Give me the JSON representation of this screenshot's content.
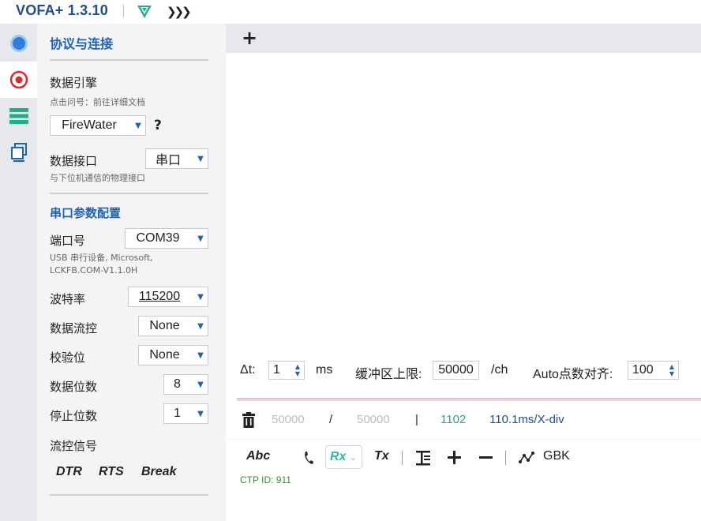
{
  "app": {
    "title": "VOFA+ 1.3.10",
    "accent": "#1f63b4"
  },
  "sidebar_icons": [
    {
      "name": "connection-dot-icon"
    },
    {
      "name": "record-icon"
    },
    {
      "name": "menu-list-icon"
    },
    {
      "name": "windows-copy-icon"
    }
  ],
  "panel": {
    "title": "协议与连接",
    "engine": {
      "label": "数据引擎",
      "hint": "点击问号：前往详细文档",
      "value": "FireWater",
      "help": "?"
    },
    "interface": {
      "label": "数据接口",
      "value": "串口",
      "hint": "与下位机通信的物理接口"
    },
    "serial_title": "串口参数配置",
    "port": {
      "label": "端口号",
      "value": "COM39",
      "hint_line1": "USB 串行设备, Microsoft,",
      "hint_line2": "LCKFB.COM-V1.1.0H"
    },
    "baud": {
      "label": "波特率",
      "value": "115200"
    },
    "flow": {
      "label": "数据流控",
      "value": "None"
    },
    "parity": {
      "label": "校验位",
      "value": "None"
    },
    "databits": {
      "label": "数据位数",
      "value": "8"
    },
    "stopbits": {
      "label": "停止位数",
      "value": "1"
    },
    "flow_signal": {
      "label": "流控信号",
      "dtr": "DTR",
      "rts": "RTS",
      "brk": "Break"
    }
  },
  "tabs": {
    "add_label": "+"
  },
  "controls": {
    "dt_label": "Δt:",
    "dt_value": "1",
    "dt_unit": "ms",
    "buffer_label": "缓冲区上限:",
    "buffer_value": "50000",
    "buffer_unit": "/ch",
    "align_label": "Auto点数对齐:",
    "align_value": "100"
  },
  "status": {
    "count_a": "50000",
    "slash": "/",
    "count_b": "50000",
    "bar": "|",
    "rate": "1102",
    "xdiv": "110.1ms/X-div"
  },
  "toolbar": {
    "abc": "Abc",
    "rx": "Rx",
    "tx": "Tx",
    "encoding": "GBK",
    "ctp_id": "CTP ID: 911"
  }
}
